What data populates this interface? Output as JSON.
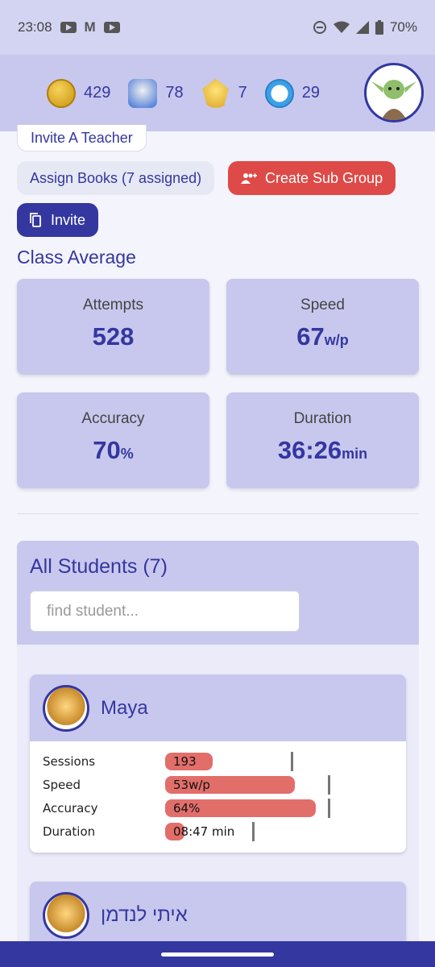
{
  "status_bar": {
    "time": "23:08",
    "battery": "70%",
    "icons": [
      "youtube-icon",
      "gmail-icon",
      "youtube-icon",
      "dnd-icon",
      "wifi-icon",
      "signal-icon",
      "battery-icon"
    ]
  },
  "top_stats": [
    {
      "icon": "coin-icon",
      "value": "429"
    },
    {
      "icon": "robot-icon",
      "value": "78"
    },
    {
      "icon": "trophy-icon",
      "value": "7"
    },
    {
      "icon": "timer-icon",
      "value": "29"
    }
  ],
  "buttons": {
    "invite_teacher": "Invite A Teacher",
    "assign_books": "Assign Books (7 assigned)",
    "create_sub_group": "Create Sub Group",
    "invite": "Invite"
  },
  "class_average": {
    "title": "Class Average",
    "cards": [
      {
        "label": "Attempts",
        "value": "528",
        "unit": ""
      },
      {
        "label": "Speed",
        "value": "67",
        "unit": "w/p"
      },
      {
        "label": "Accuracy",
        "value": "70",
        "unit": "%"
      },
      {
        "label": "Duration",
        "value": "36:26",
        "unit": "min"
      }
    ]
  },
  "students": {
    "title": "All Students (7)",
    "search_placeholder": "find student...",
    "list": [
      {
        "name": "Maya",
        "metrics": [
          {
            "label": "Sessions",
            "text": "193",
            "fill": 0.27,
            "marker": 0.71
          },
          {
            "label": "Speed",
            "text": "53w/p",
            "fill": 0.73,
            "marker": 0.92
          },
          {
            "label": "Accuracy",
            "text": "64%",
            "fill": 0.85,
            "marker": 0.92
          },
          {
            "label": "Duration",
            "text": "08:47 min",
            "fill": 0.11,
            "marker": 0.49
          }
        ]
      },
      {
        "name": "איתי לנדמן",
        "metrics": []
      }
    ]
  },
  "colors": {
    "primary": "#3437a0",
    "panel": "#c8c8ee",
    "danger": "#de4a47",
    "bar": "#e26e6a"
  }
}
